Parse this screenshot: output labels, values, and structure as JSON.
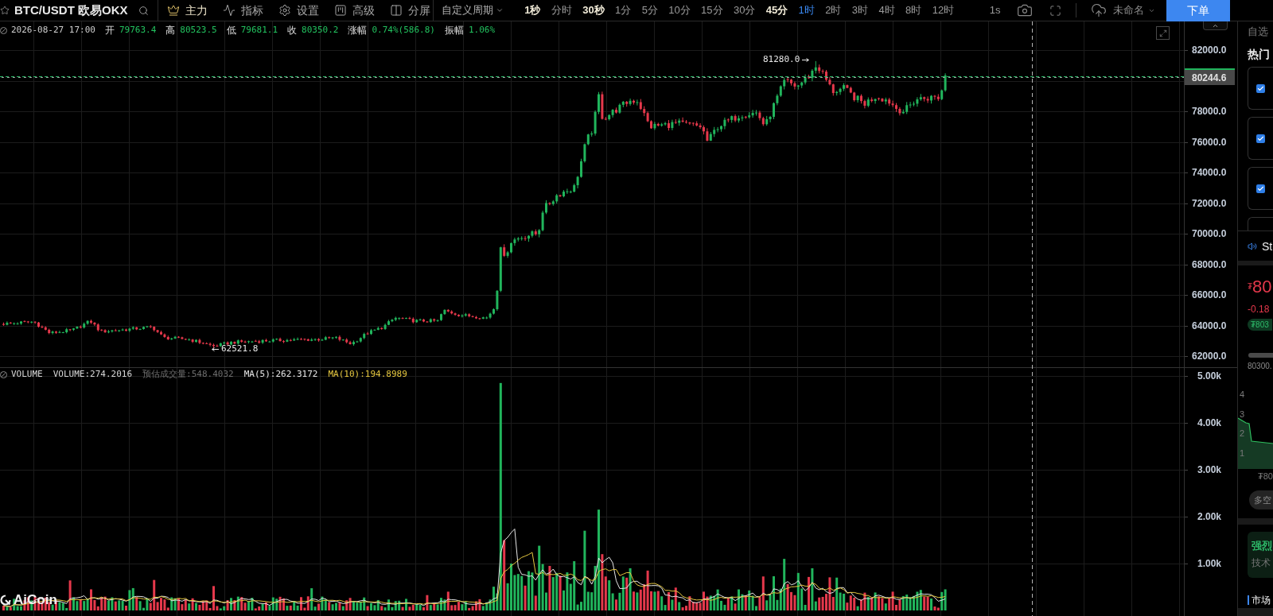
{
  "toolbar": {
    "symbol": "BTC/USDT 欧易OKX",
    "tools": [
      {
        "kind": "crown",
        "label": "主力",
        "highlighted": true
      },
      {
        "kind": "indicator",
        "label": "指标",
        "highlighted": false
      },
      {
        "kind": "settings",
        "label": "设置",
        "highlighted": false
      },
      {
        "kind": "advanced",
        "label": "高级",
        "highlighted": false
      },
      {
        "kind": "split",
        "label": "分屏",
        "highlighted": false
      }
    ],
    "custom_period": "自定义周期",
    "periods": [
      {
        "label": "1秒",
        "selected": false,
        "highlighted": true
      },
      {
        "label": "分时",
        "selected": false,
        "highlighted": false
      },
      {
        "label": "30秒",
        "selected": false,
        "highlighted": true
      },
      {
        "label": "1分",
        "selected": false,
        "highlighted": false
      },
      {
        "label": "5分",
        "selected": false,
        "highlighted": false
      },
      {
        "label": "10分",
        "selected": false,
        "highlighted": false
      },
      {
        "label": "15分",
        "selected": false,
        "highlighted": false
      },
      {
        "label": "30分",
        "selected": false,
        "highlighted": false
      },
      {
        "label": "45分",
        "selected": false,
        "highlighted": true
      },
      {
        "label": "1时",
        "selected": true,
        "highlighted": false
      },
      {
        "label": "2时",
        "selected": false,
        "highlighted": false
      },
      {
        "label": "3时",
        "selected": false,
        "highlighted": false
      },
      {
        "label": "4时",
        "selected": false,
        "highlighted": false
      },
      {
        "label": "8时",
        "selected": false,
        "highlighted": false
      },
      {
        "label": "12时",
        "selected": false,
        "highlighted": false
      }
    ],
    "interval": "1s",
    "layout_name": "未命名",
    "order_button": "下单"
  },
  "info_bar": {
    "time": "2026-08-27 17:00",
    "fields": [
      {
        "label": "开",
        "value": "79763.4"
      },
      {
        "label": "高",
        "value": "80523.5"
      },
      {
        "label": "低",
        "value": "79681.1"
      },
      {
        "label": "收",
        "value": "80350.2"
      },
      {
        "label": "涨幅",
        "value": "0.74%(586.8)"
      },
      {
        "label": "振幅",
        "value": "1.06%"
      }
    ]
  },
  "price_chart": {
    "yticks": [
      "82000.0",
      "78000.0",
      "76000.0",
      "74000.0",
      "72000.0",
      "70000.0",
      "68000.0",
      "66000.0",
      "64000.0",
      "62000.0"
    ],
    "last_price": "80244.6",
    "high_label": "81280.0",
    "low_label": "62521.8",
    "logo": "AiCoin"
  },
  "volume_chart": {
    "name": "VOLUME",
    "readings": [
      {
        "kind": "volume",
        "text": "VOLUME:274.2016",
        "color": "#d9d9d9"
      },
      {
        "kind": "estimate",
        "text": "预估成交量:548.4032",
        "color": "#6e6e6e"
      },
      {
        "kind": "ma",
        "text": "MA(5):262.3172",
        "color": "#e8e8e8"
      },
      {
        "kind": "ma",
        "text": "MA(10):194.8989",
        "color": "#e6c840"
      }
    ],
    "yticks": [
      "5.00k",
      "4.00k",
      "3.00k",
      "2.00k",
      "1.00k"
    ]
  },
  "side_panel": {
    "tab": "自选",
    "section_title": "热门",
    "cards": [
      {
        "checked": true
      },
      {
        "checked": true
      },
      {
        "checked": true
      }
    ],
    "ticker": "St",
    "price": {
      "currency": "₮",
      "value": "80"
    },
    "change": "-0.18",
    "converted": "₮803",
    "range_label": "80300.",
    "area_labels": [
      "4",
      "3",
      "2",
      "1"
    ],
    "area_footer": "₮80",
    "ratio_button": "多空",
    "signal": {
      "title": "强烈",
      "subtitle": "技术"
    },
    "market_tab": {
      "label": "市场",
      "selected": true
    }
  }
}
